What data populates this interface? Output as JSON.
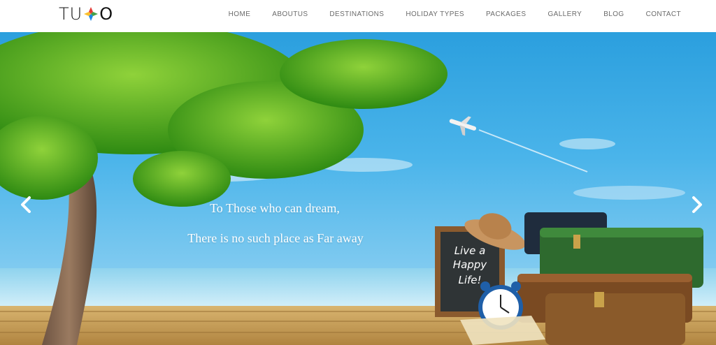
{
  "brand": {
    "logo_left": "TU",
    "logo_right": "O"
  },
  "nav": {
    "items": [
      {
        "label": "HOME"
      },
      {
        "label": "ABOUTUS"
      },
      {
        "label": "DESTINATIONS"
      },
      {
        "label": "HOLIDAY TYPES"
      },
      {
        "label": "PACKAGES"
      },
      {
        "label": "GALLERY"
      },
      {
        "label": "BLOG"
      },
      {
        "label": "CONTACT"
      }
    ]
  },
  "hero": {
    "line1": "To Those who can dream,",
    "line2": "There is no such place as Far away",
    "board_text": [
      "Live a",
      "Happy",
      "Life!"
    ],
    "prev_icon": "chevron-left-icon",
    "next_icon": "chevron-right-icon"
  },
  "colors": {
    "nav_text": "#6b6b6b",
    "sky": "#2b9fde",
    "tree": "#3fa61c",
    "deck": "#c9a35e"
  }
}
